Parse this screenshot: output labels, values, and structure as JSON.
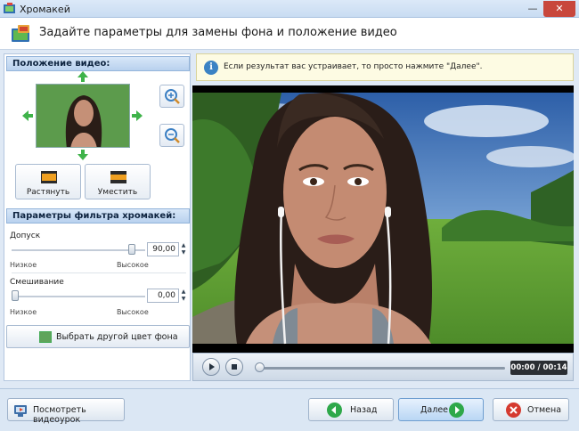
{
  "window": {
    "title": "Хромакей",
    "minimize_glyph": "—",
    "close_glyph": "✕"
  },
  "header": {
    "title": "Задайте параметры для замены фона и положение видео"
  },
  "position_panel": {
    "heading": "Положение видео:",
    "stretch_label": "Растянуть",
    "fit_label": "Уместить"
  },
  "filter_panel": {
    "heading": "Параметры фильтра хромакей:",
    "tolerance": {
      "label": "Допуск",
      "value": "90,00",
      "level": 0.9,
      "min_label": "Низкое",
      "max_label": "Высокое"
    },
    "blending": {
      "label": "Смешивание",
      "value": "0,00",
      "level": 0.0,
      "min_label": "Низкое",
      "max_label": "Высокое"
    },
    "color_button_label": "Выбрать другой цвет фона",
    "key_color": "#5fa45b"
  },
  "info": {
    "text": "Если результат вас устраивает, то просто нажмите \"Далее\"."
  },
  "player": {
    "time": "00:00 / 00:14",
    "progress": 0.0
  },
  "footer": {
    "tutorial_label": "Посмотреть видеоурок",
    "back_label": "Назад",
    "next_label": "Далее",
    "cancel_label": "Отмена"
  },
  "colors": {
    "accent": "#3b82c4",
    "back": "#2ea84a",
    "next": "#2ea84a",
    "cancel": "#d53a2f",
    "info_bg": "#fdfbe3"
  },
  "icons": [
    "app-icon",
    "chromakey-icon",
    "arrow-up-icon",
    "arrow-down-icon",
    "arrow-left-icon",
    "arrow-right-icon",
    "zoom-in-icon",
    "zoom-out-icon",
    "stretch-icon",
    "fit-icon",
    "info-icon",
    "play-icon",
    "stop-icon",
    "tutorial-icon",
    "back-icon",
    "next-icon",
    "cancel-icon"
  ]
}
